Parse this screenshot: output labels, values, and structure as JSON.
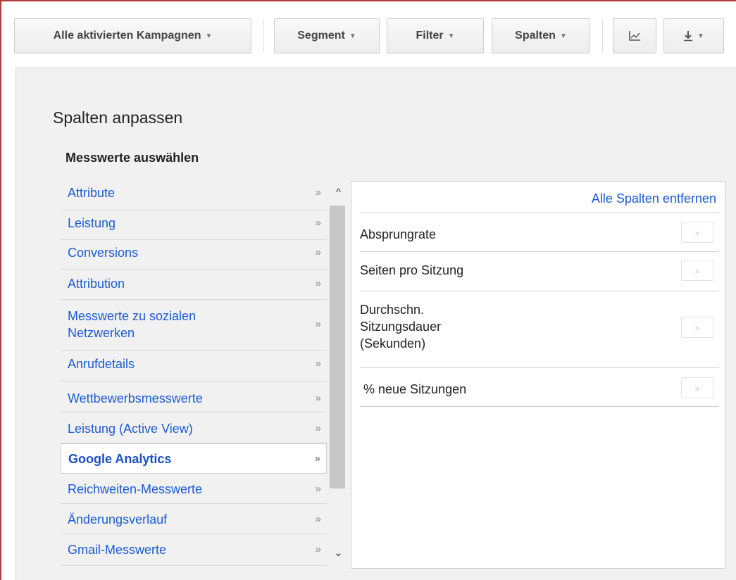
{
  "toolbar": {
    "campaigns_label": "Alle aktivierten Kampagnen",
    "segment_label": "Segment",
    "filter_label": "Filter",
    "columns_label": "Spalten",
    "caret": "▼",
    "chart_icon": "chart-icon",
    "download_icon": "download-icon"
  },
  "panel": {
    "title": "Spalten anpassen",
    "subtitle": "Messwerte auswählen",
    "categories": [
      {
        "label": "Attribute",
        "arrow": "»"
      },
      {
        "label": "Leistung",
        "arrow": "»"
      },
      {
        "label": "Conversions",
        "arrow": "»"
      },
      {
        "label": "Attribution",
        "arrow": "»"
      },
      {
        "label": "Messwerte zu sozialen Netzwerken",
        "arrow": "»"
      },
      {
        "label": "Anrufdetails",
        "arrow": "»"
      },
      {
        "label": "Wettbewerbsmesswerte",
        "arrow": "»"
      },
      {
        "label": "Leistung (Active View)",
        "arrow": "»"
      },
      {
        "label": "Google Analytics",
        "arrow": "»"
      },
      {
        "label": "Reichweiten-Messwerte",
        "arrow": "»"
      },
      {
        "label": "Änderungsverlauf",
        "arrow": "»"
      },
      {
        "label": "Gmail-Messwerte",
        "arrow": "»"
      }
    ],
    "active_category": "Google Analytics",
    "remove_all_label": "Alle Spalten entfernen",
    "metrics": [
      {
        "label": "Absprungrate",
        "action": "»"
      },
      {
        "label": "Seiten pro Sitzung",
        "action": "»"
      },
      {
        "label": "Durchschn.\nSitzungsdauer\n(Sekunden)",
        "action": "»"
      },
      {
        "label": " % neue Sitzungen",
        "action": "»"
      }
    ],
    "scroll_up": "^",
    "scroll_down": "⌄"
  },
  "colors": {
    "link": "#1a5bd8",
    "panel_bg": "#f1f1f1",
    "frame": "#b33a3a"
  }
}
